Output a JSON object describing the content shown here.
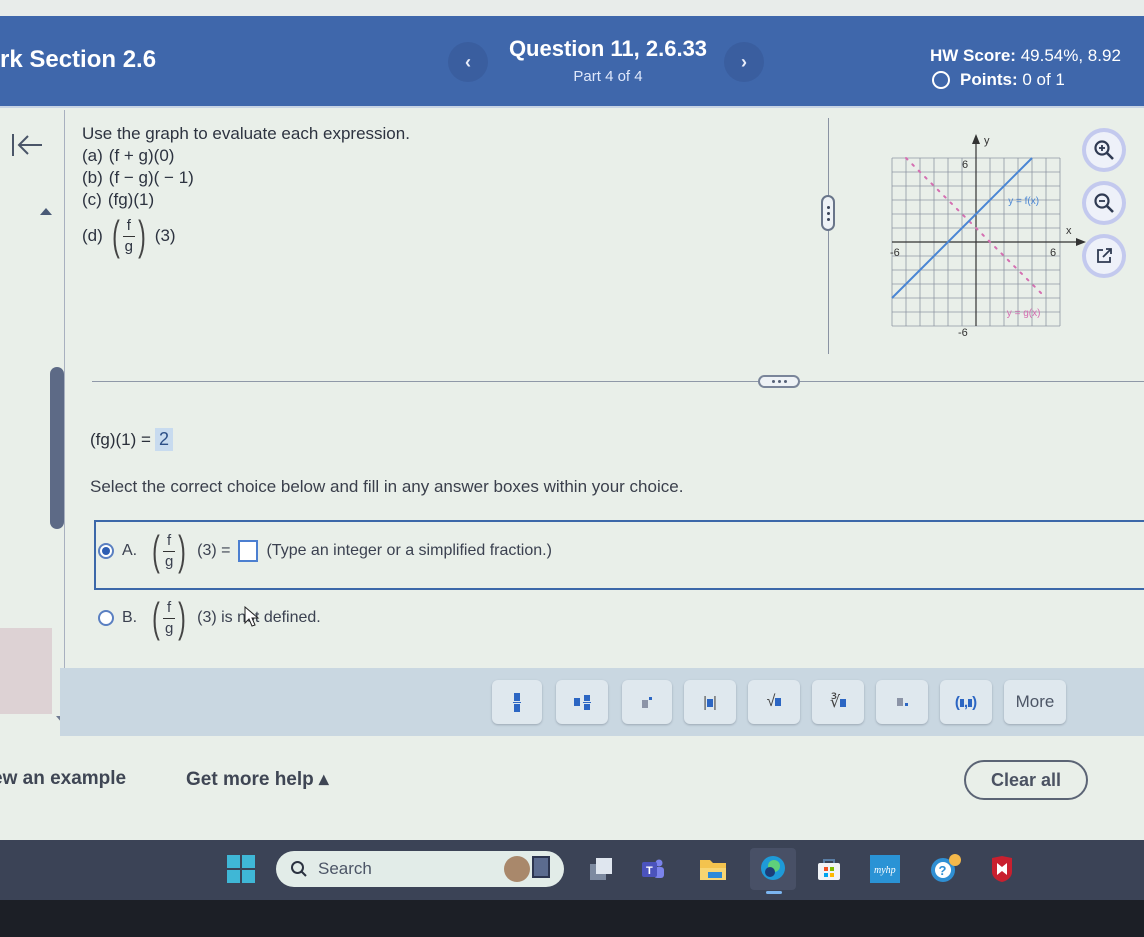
{
  "header": {
    "section_title": "rk Section 2.6",
    "question_title": "Question 11, 2.6.33",
    "part": "Part 4 of 4",
    "hw_score_label": "HW Score:",
    "hw_score_value": "49.54%, 8.92",
    "points_label": "Points:",
    "points_value": "0 of 1",
    "prev_label": "‹",
    "next_label": "›"
  },
  "question": {
    "prompt": "Use the graph to evaluate each expression.",
    "items": [
      {
        "label": "(a)",
        "expr": "(f + g)(0)"
      },
      {
        "label": "(b)",
        "expr": "(f − g)( − 1)"
      },
      {
        "label": "(c)",
        "expr": "(fg)(1)"
      },
      {
        "label": "(d)",
        "expr": "(3)",
        "fraction_num": "f",
        "fraction_den": "g"
      }
    ]
  },
  "graph": {
    "x_label": "x",
    "y_label": "y",
    "x_min_label": "-6",
    "x_max_label": "6",
    "y_max_label": "6",
    "y_min_label": "-6",
    "f_label": "y = f(x)",
    "g_label": "y = g(x)",
    "f_color": "#4a86d4",
    "g_color": "#d56fb1"
  },
  "previous_answer": {
    "expr": "(fg)(1) =",
    "value": "2"
  },
  "instructions": "Select the correct choice below and fill in any answer boxes within your choice.",
  "choices": [
    {
      "letter": "A.",
      "num": "f",
      "den": "g",
      "pre": "(3) =",
      "post": "(Type an integer or a simplified fraction.)",
      "selected": true,
      "answer_value": ""
    },
    {
      "letter": "B.",
      "num": "f",
      "den": "g",
      "pre": "(3) is not defined.",
      "selected": false
    }
  ],
  "math_toolbar": {
    "buttons": [
      "fraction",
      "mixed-number",
      "exponent",
      "absolute-value",
      "square-root",
      "nth-root",
      "decimal",
      "ordered-pair"
    ],
    "more_label": "More",
    "abs_glyph": "|",
    "sqrt_glyph": "√",
    "nroot_glyph": "∛",
    "pair_open": "(",
    "pair_close": ")"
  },
  "footer": {
    "view_example": "ew an example",
    "get_more_help": "Get more help ▴",
    "clear_all": "Clear all"
  },
  "taskbar": {
    "search_placeholder": "Search",
    "apps": [
      "start",
      "search",
      "task-view",
      "teams",
      "file-explorer",
      "edge",
      "store",
      "myhp",
      "get-help",
      "mcafee"
    ]
  },
  "accent_colors": {
    "header_bg": "#3f67ab",
    "choice_border": "#3c68a9",
    "answer_highlight": "#c8dbef"
  }
}
